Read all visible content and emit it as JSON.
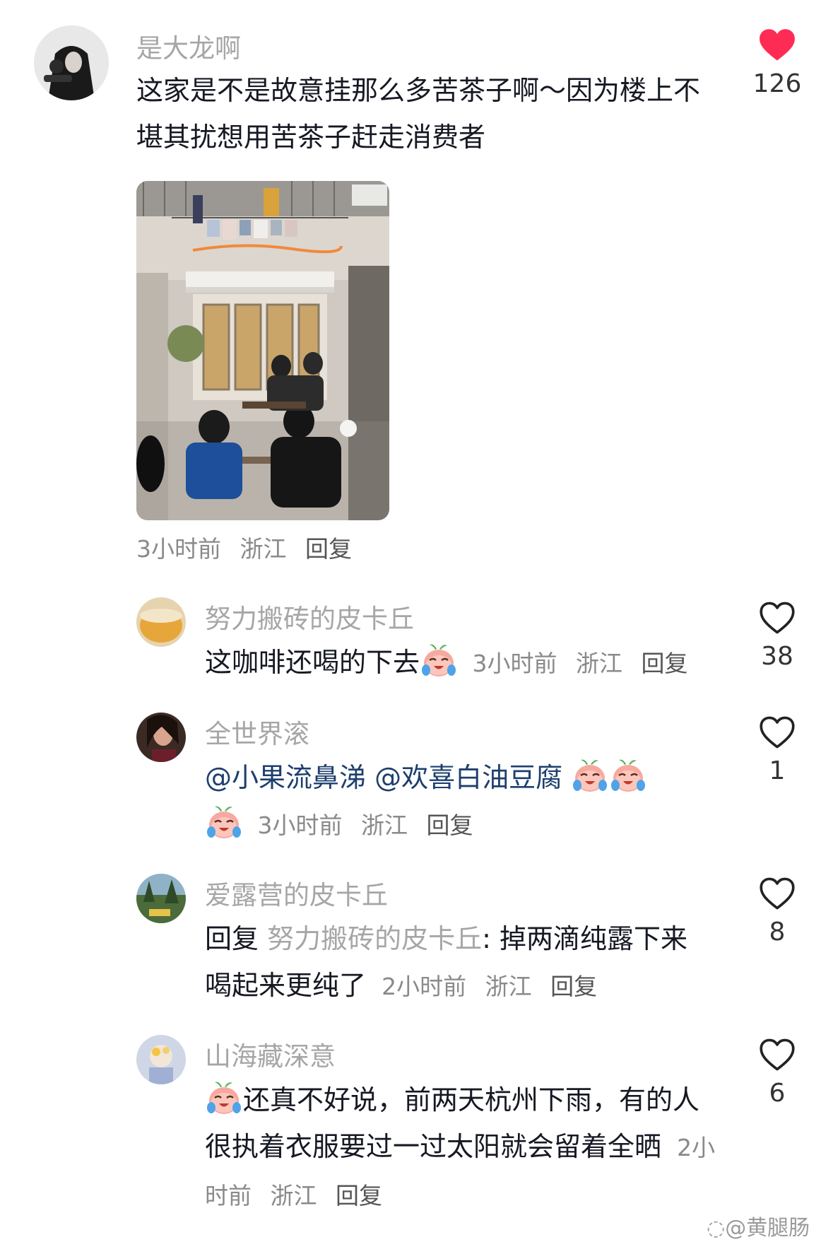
{
  "colors": {
    "like_active": "#fe2c55",
    "mention": "#1d3f6e",
    "name": "#a6a6a6",
    "text": "#161823"
  },
  "main_comment": {
    "author": "是大龙啊",
    "text": "这家是不是故意挂那么多苦茶子啊～因为楼上不堪其扰想用苦茶子赶走消费者",
    "time": "3小时前",
    "location": "浙江",
    "reply_label": "回复",
    "likes": "126",
    "liked": true
  },
  "replies": [
    {
      "author": "努力搬砖的皮卡丘",
      "text": "这咖啡还喝的下去",
      "time": "3小时前",
      "location": "浙江",
      "reply_label": "回复",
      "likes": "38"
    },
    {
      "author": "全世界滚",
      "mention1": "@小果流鼻涕",
      "mention2": "@欢喜白油豆腐",
      "time": "3小时前",
      "location": "浙江",
      "reply_label": "回复",
      "likes": "1"
    },
    {
      "author": "爱露营的皮卡丘",
      "reply_prefix": "回复",
      "reply_to": "努力搬砖的皮卡丘",
      "text": ": 掉两滴纯露下来喝起来更纯了",
      "time": "2小时前",
      "location": "浙江",
      "reply_label": "回复",
      "likes": "8"
    },
    {
      "author": "山海藏深意",
      "text": "还真不好说，前两天杭州下雨，有的人很执着衣服要过一过太阳就会留着全晒",
      "time": "2小时前",
      "location": "浙江",
      "reply_label": "回复",
      "likes": "6"
    }
  ],
  "icons": {
    "emoji": "crying-laughing-emoji",
    "like": "heart-icon"
  },
  "watermark": "@黄腿肠"
}
